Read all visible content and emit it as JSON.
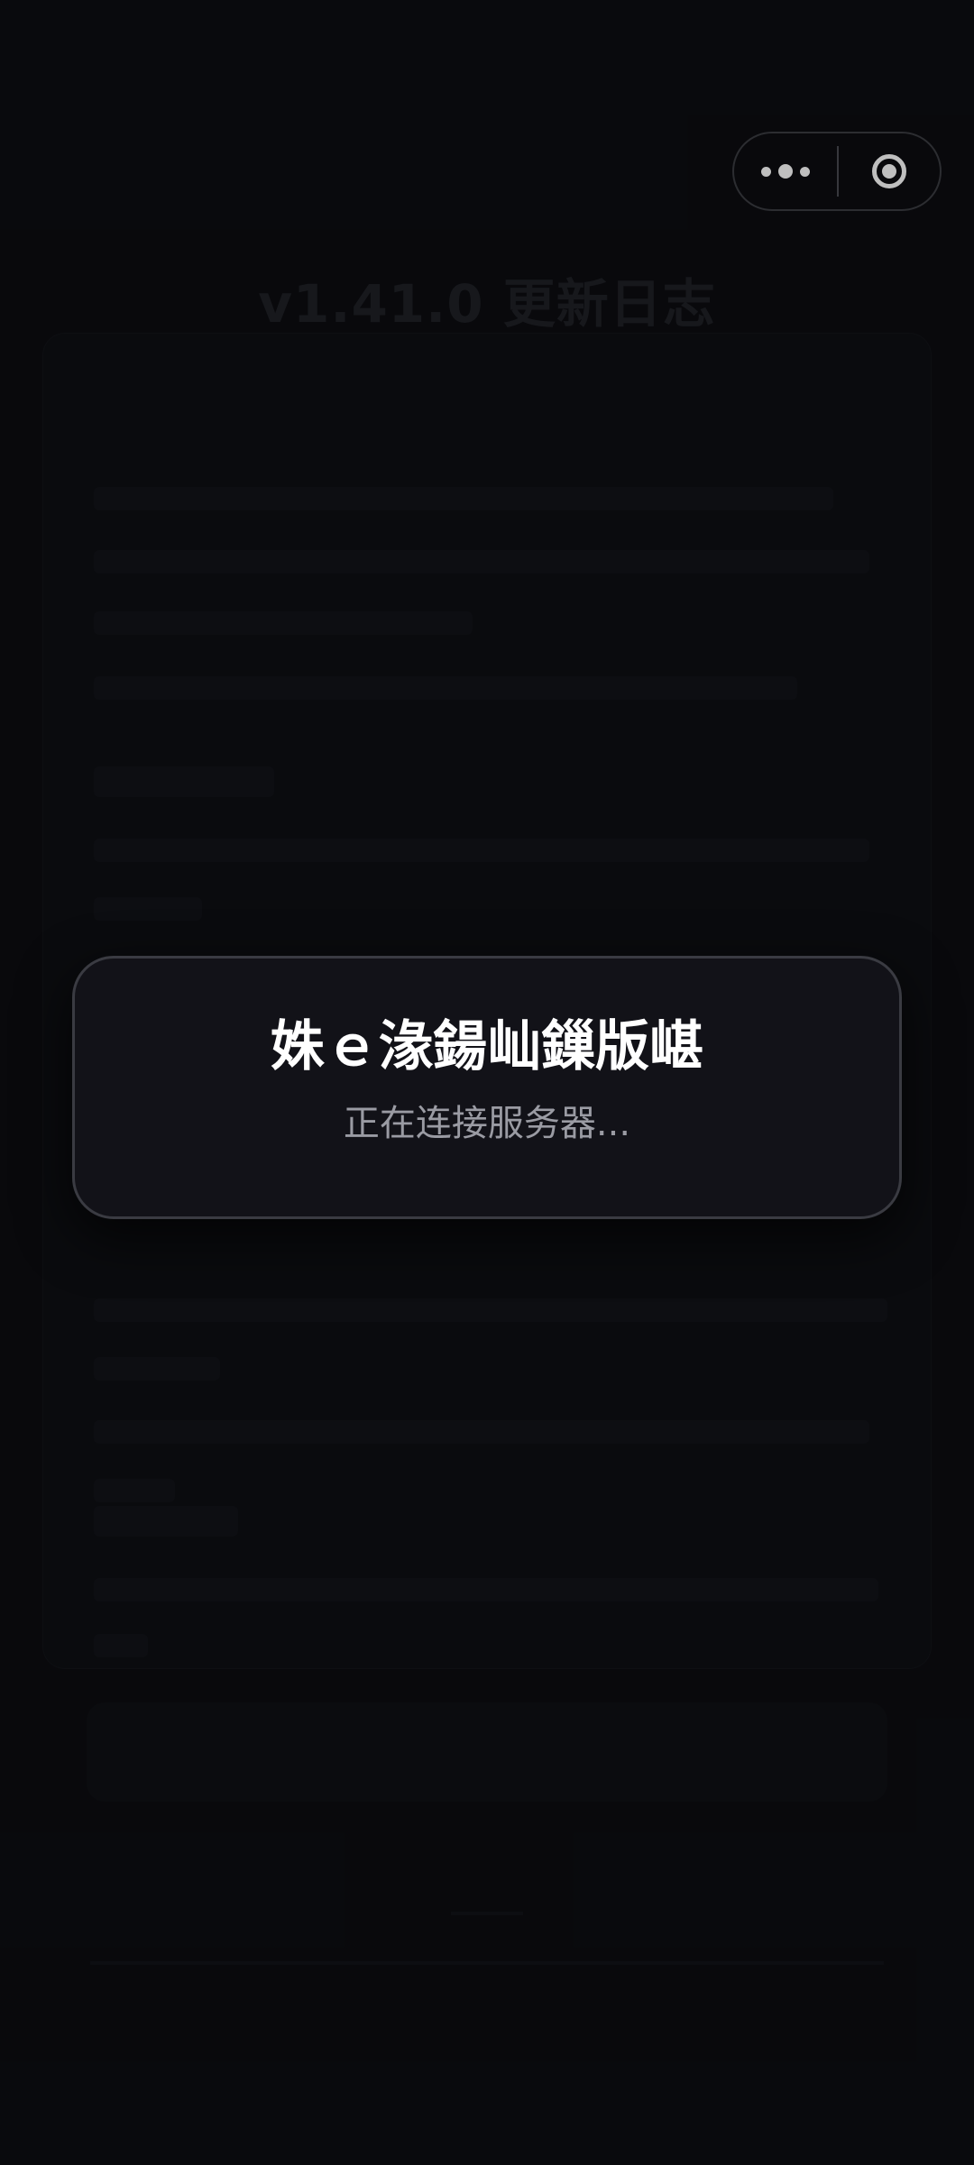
{
  "page": {
    "title": "v1.41.0 更新日志"
  },
  "capsule": {
    "more_icon": "more-dots-icon",
    "close_icon": "close-target-icon"
  },
  "dialog": {
    "title": "姝ｅ湪鍚屾鏁版嵁",
    "message": "正在连接服务器..."
  },
  "colors": {
    "background": "#0c0d11",
    "dialog_bg": "#121218",
    "dialog_border": "#3a3b42",
    "title_text": "#ffffff",
    "message_text": "#9a9ba3"
  }
}
